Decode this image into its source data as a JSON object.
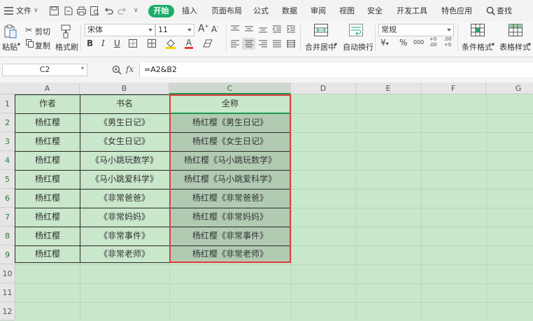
{
  "menu": {
    "file_label": "文件",
    "tabs": [
      "开始",
      "插入",
      "页面布局",
      "公式",
      "数据",
      "审阅",
      "视图",
      "安全",
      "开发工具",
      "特色应用"
    ],
    "search_label": "查找"
  },
  "ribbon": {
    "paste_label": "粘贴",
    "cut_label": "剪切",
    "copy_label": "复制",
    "format_painter_label": "格式刷",
    "font_name": "宋体",
    "font_size": "11",
    "bold": "B",
    "italic": "I",
    "underline": "U",
    "merge_label": "合并居中",
    "wrap_label": "自动换行",
    "number_format": "常规",
    "percent_label": "%",
    "thousands_label": "000",
    "decimal_inc": "+0 .00",
    "decimal_dec": ".00 +0",
    "cond_format_label": "条件格式",
    "table_style_label": "表格样式"
  },
  "formula_bar": {
    "name_box": "C2",
    "fx_label": "fx",
    "formula": "=A2&B2"
  },
  "grid": {
    "columns": [
      "A",
      "B",
      "C",
      "D",
      "E",
      "F",
      "G"
    ],
    "rows": [
      "1",
      "2",
      "3",
      "4",
      "5",
      "6",
      "7",
      "8",
      "9",
      "10",
      "11",
      "12"
    ],
    "headers": {
      "a": "作者",
      "b": "书名",
      "c": "全称"
    },
    "records": [
      {
        "author": "杨红樱",
        "title": "《男生日记》",
        "full": "杨红樱《男生日记》"
      },
      {
        "author": "杨红樱",
        "title": "《女生日记》",
        "full": "杨红樱《女生日记》"
      },
      {
        "author": "杨红樱",
        "title": "《马小跳玩数学》",
        "full": "杨红樱《马小跳玩数学》"
      },
      {
        "author": "杨红樱",
        "title": "《马小跳爱科学》",
        "full": "杨红樱《马小跳爱科学》"
      },
      {
        "author": "杨红樱",
        "title": "《非常爸爸》",
        "full": "杨红樱《非常爸爸》"
      },
      {
        "author": "杨红樱",
        "title": "《非常妈妈》",
        "full": "杨红樱《非常妈妈》"
      },
      {
        "author": "杨红樱",
        "title": "《非常事件》",
        "full": "杨红樱《非常事件》"
      },
      {
        "author": "杨红樱",
        "title": "《非常老师》",
        "full": "杨红樱《非常老师》"
      }
    ]
  },
  "colors": {
    "accent": "#1aad68",
    "sheet_bg": "#c9e7cb",
    "selection": "#b1cbb3",
    "highlight_border": "#e23a3a"
  }
}
